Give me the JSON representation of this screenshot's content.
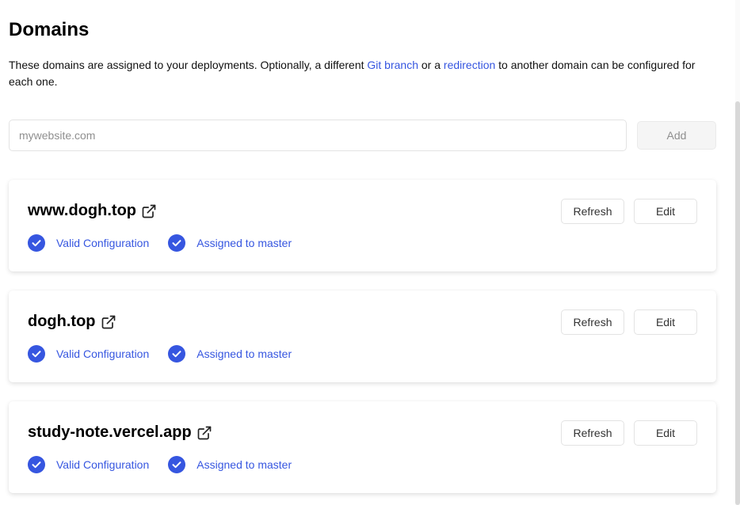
{
  "header": {
    "title": "Domains",
    "description_part1": "These domains are assigned to your deployments. Optionally, a different ",
    "link_git_branch": "Git branch",
    "description_part2": " or a ",
    "link_redirection": "redirection",
    "description_part3": " to another domain can be configured for each one."
  },
  "add_form": {
    "placeholder": "mywebsite.com",
    "value": "",
    "add_label": "Add"
  },
  "domains": [
    {
      "name": "www.dogh.top",
      "refresh_label": "Refresh",
      "edit_label": "Edit",
      "status_config": "Valid Configuration",
      "status_assigned": "Assigned to master"
    },
    {
      "name": "dogh.top",
      "refresh_label": "Refresh",
      "edit_label": "Edit",
      "status_config": "Valid Configuration",
      "status_assigned": "Assigned to master"
    },
    {
      "name": "study-note.vercel.app",
      "refresh_label": "Refresh",
      "edit_label": "Edit",
      "status_config": "Valid Configuration",
      "status_assigned": "Assigned to master"
    }
  ],
  "colors": {
    "accent": "#3656e0",
    "check_fill": "#3656e0"
  },
  "icons": {
    "external": "external-link-icon",
    "check": "check-circle-icon"
  }
}
